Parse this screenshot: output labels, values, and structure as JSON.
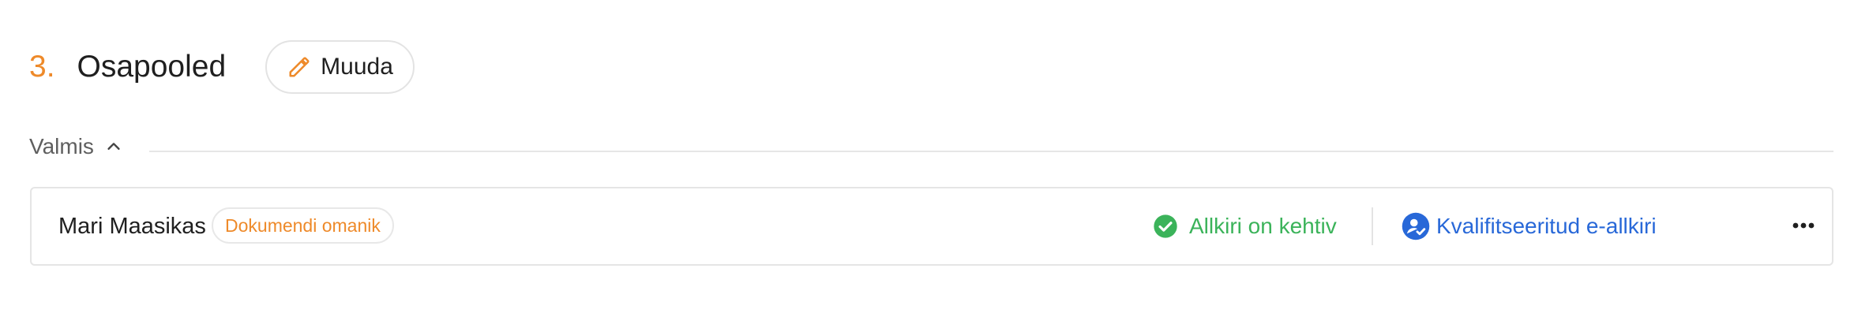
{
  "section": {
    "number": "3.",
    "title": "Osapooled",
    "edit_button_label": "Muuda"
  },
  "group": {
    "label": "Valmis",
    "expanded": true
  },
  "parties": [
    {
      "name": "Mari Maasikas",
      "role": "Dokumendi omanik",
      "status": "Allkiri on kehtiv",
      "signature_type": "Kvalifitseeritud e-allkiri"
    }
  ],
  "icons": {
    "edit": "pencil-icon",
    "collapse": "chevron-up-icon",
    "status": "check-circle-icon",
    "signature_type": "person-check-icon",
    "more": "more-horizontal-icon"
  },
  "colors": {
    "accent": "#ee8a2a",
    "success": "#3bb35a",
    "link": "#2868d8",
    "text": "#1f1f1f",
    "muted": "#5f5f5f",
    "border": "#e5e5e5"
  }
}
